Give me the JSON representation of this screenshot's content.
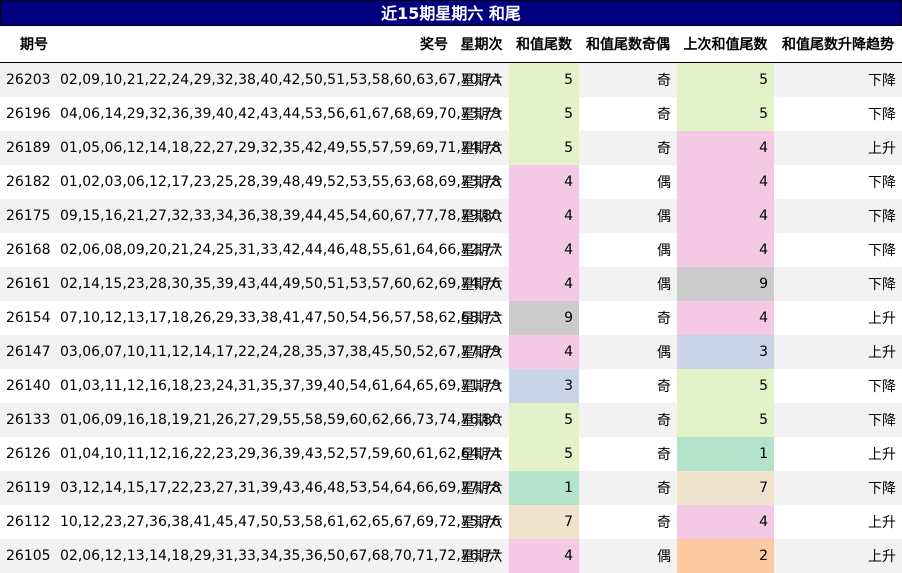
{
  "title": "近15期星期六 和尾",
  "headers": {
    "period": "期号",
    "numbers": "奖号",
    "weekday": "星期次",
    "tail": "和值尾数",
    "parity": "和值尾数奇偶",
    "prev_tail": "上次和值尾数",
    "trend": "和值尾数升降趋势"
  },
  "rows": [
    {
      "period": "26203",
      "numbers": "02,09,10,21,22,24,29,32,38,40,42,50,51,53,58,60,63,67,70,74",
      "weekday": "星期六",
      "tail": "5",
      "parity": "奇",
      "prev_tail": "5",
      "trend": "下降"
    },
    {
      "period": "26196",
      "numbers": "04,06,14,29,32,36,39,40,42,43,44,53,56,61,67,68,69,70,73,79",
      "weekday": "星期六",
      "tail": "5",
      "parity": "奇",
      "prev_tail": "5",
      "trend": "下降"
    },
    {
      "period": "26189",
      "numbers": "01,05,06,12,14,18,22,27,29,32,35,42,49,55,57,59,69,71,74,78",
      "weekday": "星期六",
      "tail": "5",
      "parity": "奇",
      "prev_tail": "4",
      "trend": "上升"
    },
    {
      "period": "26182",
      "numbers": "01,02,03,06,12,17,23,25,28,39,48,49,52,53,55,63,68,69,73,78",
      "weekday": "星期六",
      "tail": "4",
      "parity": "偶",
      "prev_tail": "4",
      "trend": "下降"
    },
    {
      "period": "26175",
      "numbers": "09,15,16,21,27,32,33,34,36,38,39,44,45,54,60,67,77,78,79,80",
      "weekday": "星期六",
      "tail": "4",
      "parity": "偶",
      "prev_tail": "4",
      "trend": "下降"
    },
    {
      "period": "26168",
      "numbers": "02,06,08,09,20,21,24,25,31,33,42,44,46,48,55,61,64,66,72,77",
      "weekday": "星期六",
      "tail": "4",
      "parity": "偶",
      "prev_tail": "4",
      "trend": "下降"
    },
    {
      "period": "26161",
      "numbers": "02,14,15,23,28,30,35,39,43,44,49,50,51,53,57,60,62,69,74,76",
      "weekday": "星期六",
      "tail": "4",
      "parity": "偶",
      "prev_tail": "9",
      "trend": "下降"
    },
    {
      "period": "26154",
      "numbers": "07,10,12,13,17,18,26,29,33,38,41,47,50,54,56,57,58,62,68,73",
      "weekday": "星期六",
      "tail": "9",
      "parity": "奇",
      "prev_tail": "4",
      "trend": "上升"
    },
    {
      "period": "26147",
      "numbers": "03,06,07,10,11,12,14,17,22,24,28,35,37,38,45,50,52,67,77,79",
      "weekday": "星期六",
      "tail": "4",
      "parity": "偶",
      "prev_tail": "3",
      "trend": "上升"
    },
    {
      "period": "26140",
      "numbers": "01,03,11,12,16,18,23,24,31,35,37,39,40,54,61,64,65,69,71,79",
      "weekday": "星期六",
      "tail": "3",
      "parity": "奇",
      "prev_tail": "5",
      "trend": "下降"
    },
    {
      "period": "26133",
      "numbers": "01,06,09,16,18,19,21,26,27,29,55,58,59,60,62,66,73,74,76,80",
      "weekday": "星期六",
      "tail": "5",
      "parity": "奇",
      "prev_tail": "5",
      "trend": "下降"
    },
    {
      "period": "26126",
      "numbers": "01,04,10,11,12,16,22,23,29,36,39,43,52,57,59,60,61,62,64,74",
      "weekday": "星期六",
      "tail": "5",
      "parity": "奇",
      "prev_tail": "1",
      "trend": "上升"
    },
    {
      "period": "26119",
      "numbers": "03,12,14,15,17,22,23,27,31,39,43,46,48,53,54,64,66,69,77,78",
      "weekday": "星期六",
      "tail": "1",
      "parity": "奇",
      "prev_tail": "7",
      "trend": "下降"
    },
    {
      "period": "26112",
      "numbers": "10,12,23,27,36,38,41,45,47,50,53,58,61,62,65,67,69,72,75,76",
      "weekday": "星期六",
      "tail": "7",
      "parity": "奇",
      "prev_tail": "4",
      "trend": "上升"
    },
    {
      "period": "26105",
      "numbers": "02,06,12,13,14,18,29,31,33,34,35,36,50,67,68,70,71,72,76,77",
      "weekday": "星期六",
      "tail": "4",
      "parity": "偶",
      "prev_tail": "2",
      "trend": "上升"
    }
  ]
}
